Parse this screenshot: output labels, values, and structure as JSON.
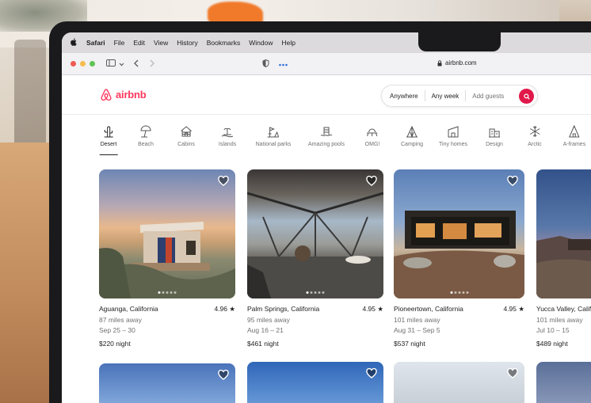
{
  "menubar": {
    "app": "Safari",
    "items": [
      "File",
      "Edit",
      "View",
      "History",
      "Bookmarks",
      "Window",
      "Help"
    ]
  },
  "toolbar": {
    "url": "airbnb.com"
  },
  "header": {
    "logo_text": "airbnb",
    "brand_color": "#ff385c",
    "search": {
      "where": "Anywhere",
      "when": "Any week",
      "who": "Add guests"
    }
  },
  "categories": [
    {
      "label": "Desert",
      "icon": "cactus-icon",
      "active": true
    },
    {
      "label": "Beach",
      "icon": "umbrella-icon"
    },
    {
      "label": "Cabins",
      "icon": "cabin-icon"
    },
    {
      "label": "Islands",
      "icon": "island-icon"
    },
    {
      "label": "National parks",
      "icon": "national-park-icon"
    },
    {
      "label": "Amazing pools",
      "icon": "pool-icon"
    },
    {
      "label": "OMG!",
      "icon": "ufo-icon"
    },
    {
      "label": "Camping",
      "icon": "tent-icon"
    },
    {
      "label": "Tiny homes",
      "icon": "tiny-home-icon"
    },
    {
      "label": "Design",
      "icon": "design-icon"
    },
    {
      "label": "Arctic",
      "icon": "snowflake-icon"
    },
    {
      "label": "A-frames",
      "icon": "a-frame-icon"
    }
  ],
  "listings": [
    {
      "location": "Aguanga, California",
      "rating": "4.96 ★",
      "distance": "87 miles away",
      "dates": "Sep 25 – 30",
      "price": "$220",
      "unit": "night"
    },
    {
      "location": "Palm Springs, California",
      "rating": "4.95 ★",
      "distance": "95 miles away",
      "dates": "Aug 16 – 21",
      "price": "$461",
      "unit": "night"
    },
    {
      "location": "Pioneertown, California",
      "rating": "4.95 ★",
      "distance": "101 miles away",
      "dates": "Aug 31 – Sep 5",
      "price": "$537",
      "unit": "night"
    },
    {
      "location": "Yucca Valley, Califo",
      "rating": "",
      "distance": "101 miles away",
      "dates": "Jul 10 – 15",
      "price": "$489",
      "unit": "night"
    }
  ]
}
